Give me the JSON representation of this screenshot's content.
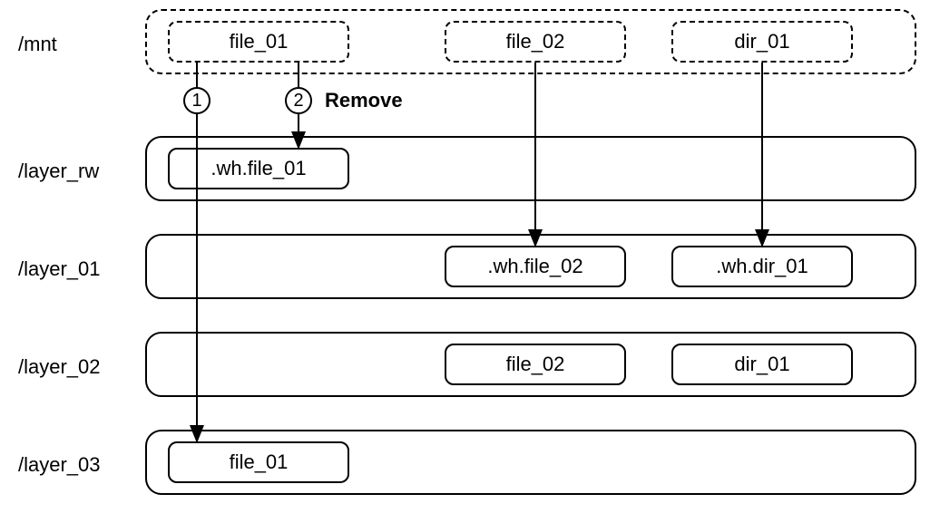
{
  "rows": {
    "mnt": {
      "label": "/mnt",
      "files": [
        "file_01",
        "file_02",
        "dir_01"
      ]
    },
    "rw": {
      "label": "/layer_rw",
      "files": [
        ".wh.file_01"
      ]
    },
    "l01": {
      "label": "/layer_01",
      "files": [
        ".wh.file_02",
        ".wh.dir_01"
      ]
    },
    "l02": {
      "label": "/layer_02",
      "files": [
        "file_02",
        "dir_01"
      ]
    },
    "l03": {
      "label": "/layer_03",
      "files": [
        "file_01"
      ]
    }
  },
  "steps": {
    "s1": "1",
    "s2": "2"
  },
  "annotations": {
    "remove": "Remove"
  }
}
